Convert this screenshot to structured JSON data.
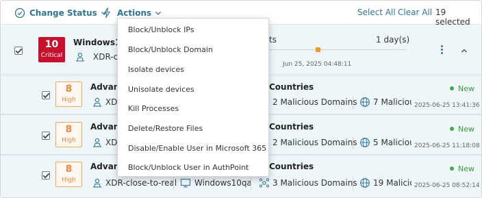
{
  "toolbar": {
    "change_status": "Change Status",
    "actions": "Actions",
    "select_all": "Select All",
    "clear_all": "Clear All",
    "selected_count": "19 selected"
  },
  "parent_row": {
    "severity_number": "10",
    "severity_label": "Critical",
    "device_title": "Windows10",
    "sub_text": "XDR-clo",
    "label_partial": "ts",
    "duration": "1 day(s)",
    "timeline_date": "Jun 25, 2025 04:48:11"
  },
  "incidents": [
    {
      "severity_number": "8",
      "severity_label": "High",
      "title": "Advanc",
      "title_right": "Countries",
      "source": "XD",
      "domains": "2 Malicious Domains",
      "ips": "7 Maliciou",
      "status": "New",
      "timestamp": "2025-06-25 13:41:36"
    },
    {
      "severity_number": "8",
      "severity_label": "High",
      "title": "Advanc",
      "title_right": "Countries",
      "source": "XD",
      "domains": "2 Malicious Domains",
      "ips": "5 Maliciou",
      "status": "New",
      "timestamp": "2025-06-25 11:18:08"
    },
    {
      "severity_number": "8",
      "severity_label": "High",
      "title": "Advanc",
      "title_right": "Countries",
      "source": "XDR-close-to-real",
      "device": "Windows10qa",
      "domains": "3 Malicious Domains",
      "ips": "19 Malicio",
      "status": "New",
      "timestamp": "2025-06-25 08:52:14"
    }
  ],
  "actions_menu": {
    "items": [
      "Block/Unblock IPs",
      "Block/Unblock Domain",
      "Isolate devices",
      "Unisolate devices",
      "Kill Processes",
      "Delete/Restore Files",
      "Disable/Enable User in Microsoft 365",
      "Block/Unblock User in AuthPoint"
    ]
  },
  "colors": {
    "accent": "#2f7595",
    "critical": "#c8102e",
    "high": "#e8893b",
    "status_new": "#3a9a3a",
    "row_bg": "#eef6fa"
  }
}
